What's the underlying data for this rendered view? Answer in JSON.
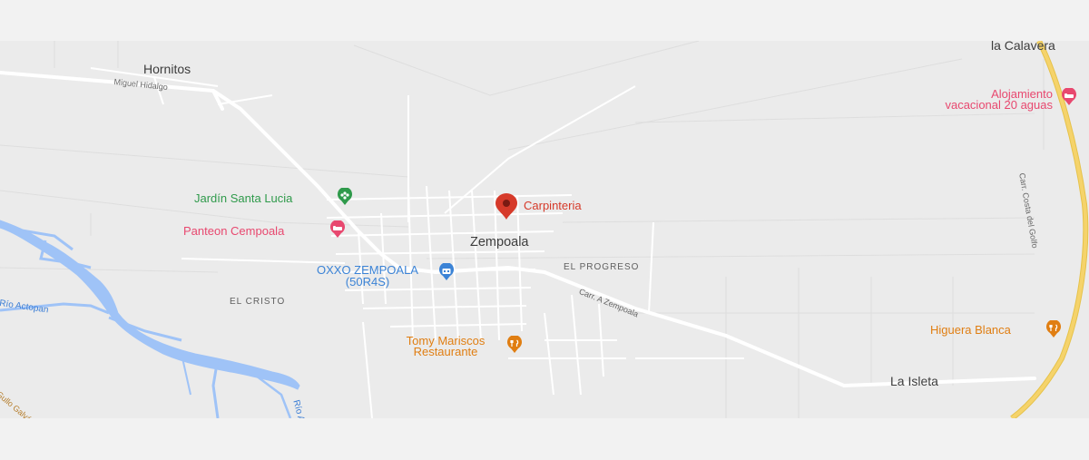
{
  "map": {
    "places": {
      "hornitos": "Hornitos",
      "la_calavera": "la Calavera",
      "zempoala": "Zempoala",
      "la_isleta": "La Isleta"
    },
    "districts": {
      "el_progreso": "EL PROGRESO",
      "el_cristo": "EL CRISTO"
    },
    "roads": {
      "miguel_hidalgo": "Miguel Hidalgo",
      "carr_costa": "Carr. Costa del Golfo",
      "carr_zempoala": "Carr. A Zempoala",
      "rio_actopan": "Río Actopan",
      "bottom_left": "Gullo Galván",
      "bottom_river": "Río A"
    },
    "pois": {
      "alojamiento_line1": "Alojamiento",
      "alojamiento_line2": "vacacional 20 aguas",
      "jardin": "Jardín Santa Lucia",
      "panteon": "Panteon Cempoala",
      "oxxo_line1": "OXXO ZEMPOALA",
      "oxxo_line2": "(50R4S)",
      "carpinteria": "Carpinteria",
      "tomy_line1": "Tomy Mariscos",
      "tomy_line2": "Restaurante",
      "higuera": "Higuera Blanca"
    },
    "icons": {
      "lodging": "bed-icon",
      "park": "tree-icon",
      "cemetery": "bed-icon",
      "store": "shopping-icon",
      "pin": "location-pin-icon",
      "food": "fork-knife-icon"
    },
    "colors": {
      "background": "#ebebeb",
      "water": "#9fc3f7",
      "highway": "#f5d36b",
      "pink": "#e8486f",
      "green": "#2f9a4b",
      "blue": "#3b83d6",
      "orange": "#e07e12",
      "red": "#d63a2a"
    }
  }
}
